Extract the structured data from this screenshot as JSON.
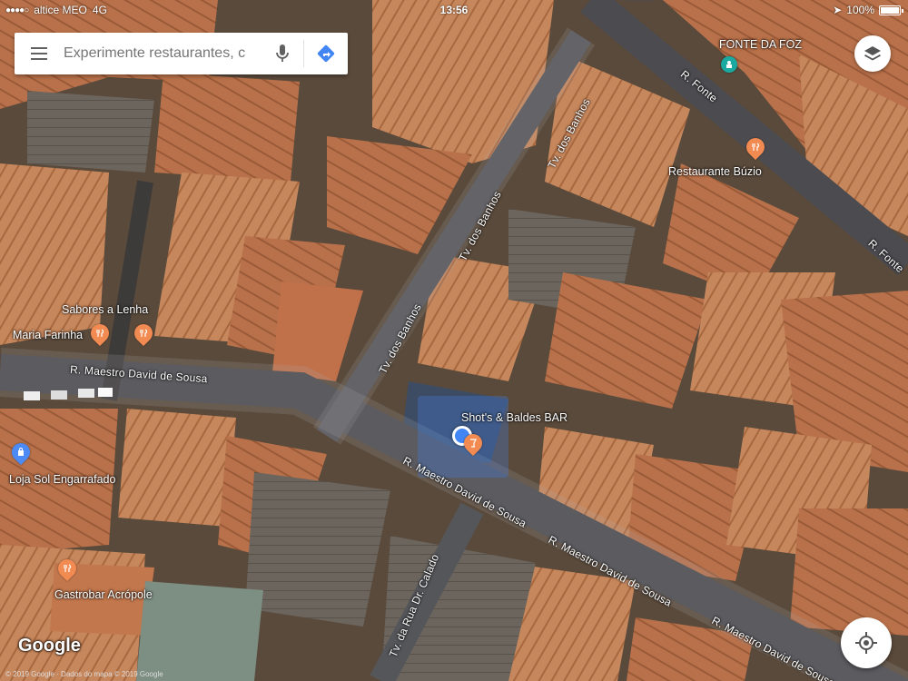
{
  "status_bar": {
    "carrier": "altice MEO",
    "network": "4G",
    "time": "13:56",
    "battery": "100%",
    "battery_level": 1.0
  },
  "search": {
    "placeholder": "Experimente restaurantes, c"
  },
  "places": {
    "fonte_da_foz": "FONTE DA FOZ",
    "restaurante_buzio": "Restaurante Búzio",
    "sabores_a_lenha": "Sabores a Lenha",
    "maria_farinha": "Maria Farinha",
    "shots_baldes": "Shot's & Baldes BAR",
    "loja_sol": "Loja Sol Engarrafado",
    "gastrobar": "Gastrobar Acrópole"
  },
  "streets": {
    "r_fonte_1": "R. Fonte",
    "r_fonte_2": "R. Fonte",
    "tv_banhos_1": "Tv. dos Banhos",
    "tv_banhos_2": "Tv. dos Banhos",
    "tv_banhos_3": "Tv. dos Banhos",
    "maestro_1": "R. Maestro David de Sousa",
    "maestro_2": "R. Maestro David de Sousa",
    "maestro_3": "R. Maestro David de Sousa",
    "maestro_4": "R. Maestro David de Sousa",
    "tv_calado": "Tv. da Rua Dr. Calado"
  },
  "colors": {
    "poi_food": "#f28b52",
    "poi_blue": "#4c8bf5",
    "poi_teal": "#1aa9a0",
    "location_blue": "#4285f4"
  },
  "branding": {
    "logo": "Google",
    "copyright": "© 2019 Google · Dados do mapa © 2019 Google"
  }
}
